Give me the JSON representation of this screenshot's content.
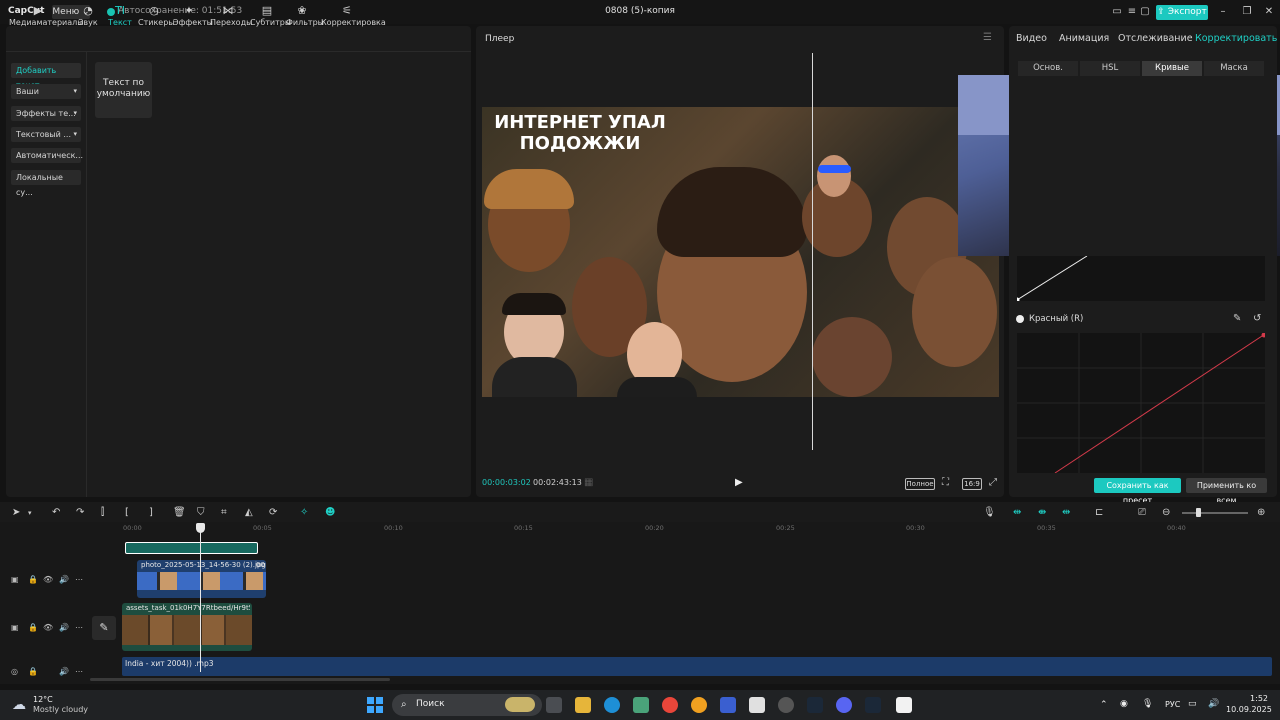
{
  "app": {
    "logo": "CapCut",
    "menu_label": "Меню",
    "autosave": "Автосохранение: 01:51:53",
    "project_title": "0808 (5)-копия",
    "export_label": "Экспорт"
  },
  "left_toolbar": [
    {
      "label": "Медиаматериалы",
      "icon": "media-icon"
    },
    {
      "label": "Звук",
      "icon": "audio-icon"
    },
    {
      "label": "Текст",
      "icon": "text-icon"
    },
    {
      "label": "Стикеры",
      "icon": "sticker-icon"
    },
    {
      "label": "Эффекты",
      "icon": "effects-icon"
    },
    {
      "label": "Переходы",
      "icon": "transitions-icon"
    },
    {
      "label": "Субтитры",
      "icon": "subtitles-icon"
    },
    {
      "label": "Фильтры",
      "icon": "filters-icon"
    },
    {
      "label": "Корректировка",
      "icon": "adjust-icon"
    }
  ],
  "text_sidebar": [
    {
      "label": "Добавить текст"
    },
    {
      "label": "Ваши"
    },
    {
      "label": "Эффекты те..."
    },
    {
      "label": "Текстовый ..."
    },
    {
      "label": "Автоматическ..."
    },
    {
      "label": "Локальные су..."
    }
  ],
  "default_text_card": "Текст по умолчанию",
  "player": {
    "label": "Плеер",
    "caption_line1": "ИНТЕРНЕТ УПАЛ",
    "caption_line2": "ПОДОЖЖИ",
    "time_current": "00:00:03:02",
    "time_total": "00:02:43:13",
    "full_label": "Полное",
    "ratio_label": "16:9"
  },
  "right_panel": {
    "tabs": [
      "Видео",
      "Анимация",
      "Отслеживание",
      "Корректировать"
    ],
    "subtabs": [
      "Основ.",
      "HSL",
      "Кривые",
      "Маска"
    ],
    "red_channel_label": "Красный (R)",
    "save_preset": "Сохранить как пресет",
    "apply_all": "Применить ко всем"
  },
  "timeline": {
    "ruler": [
      "00:00",
      "00:05",
      "00:10",
      "00:15",
      "00:20",
      "00:25",
      "00:30",
      "00:35",
      "00:40"
    ],
    "photo_clip_label": "photo_2025-05-13_14-56-30 (2).jpg",
    "photo_clip_duration": "00",
    "main_clip_label": "assets_task_01k0H7Y7Rtbeed/Hr9t51fv8hs",
    "audio_clip_label": "India - хит 2004)) .mp3"
  },
  "taskbar": {
    "weather_temp": "12°C",
    "weather_desc": "Mostly cloudy",
    "search_placeholder": "Поиск",
    "language": "РУС",
    "time": "1:52",
    "date": "10.09.2025"
  },
  "colors": {
    "accent": "#1cc9c0",
    "panel_bg": "#1c1c1c",
    "audio_clip": "#1c3b69",
    "red_curve": "#d23a4a"
  }
}
